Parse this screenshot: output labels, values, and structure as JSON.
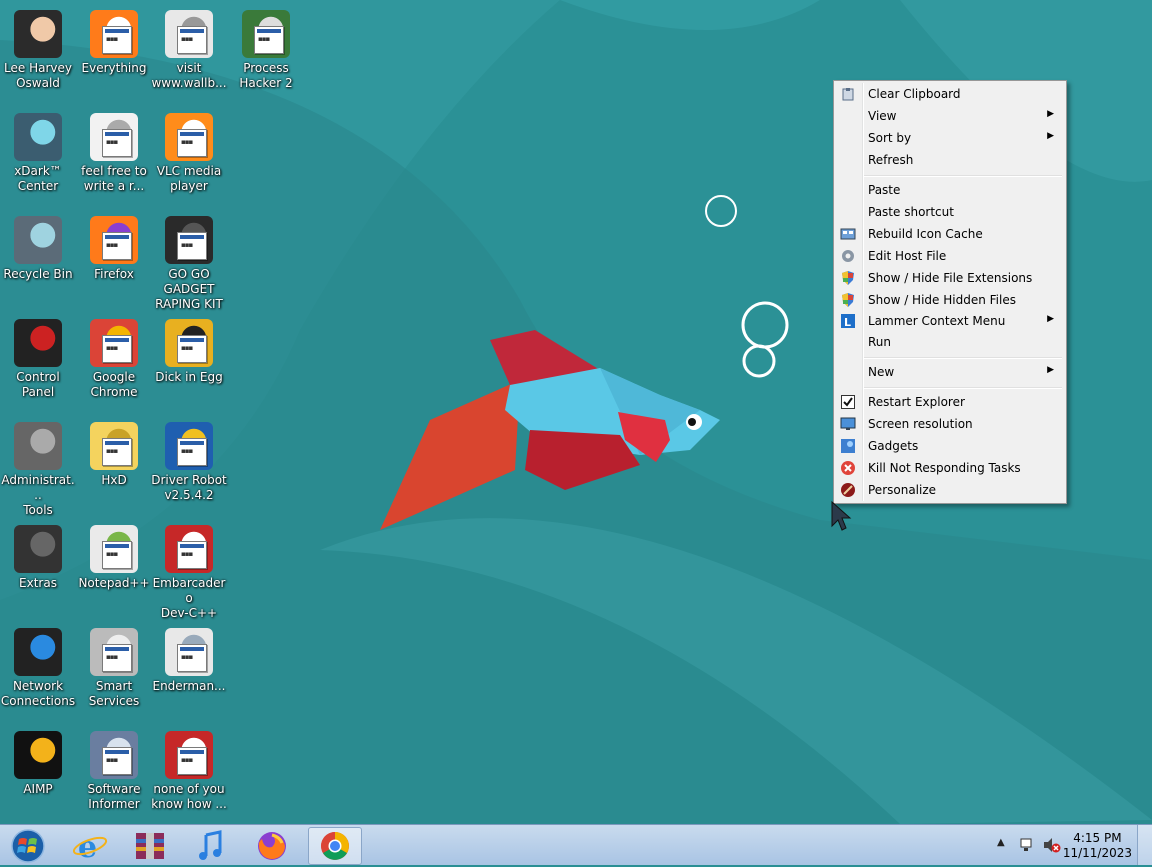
{
  "desktop_icons": [
    {
      "label": "Lee Harvey\nOswald"
    },
    {
      "label": "Everything"
    },
    {
      "label": "visit\nwww.wallb..."
    },
    {
      "label": "Process\nHacker 2"
    },
    {
      "label": "xDark™\nCenter"
    },
    {
      "label": "feel free to\nwrite a r..."
    },
    {
      "label": "VLC media\nplayer"
    },
    {
      "label": "Recycle Bin"
    },
    {
      "label": "Firefox"
    },
    {
      "label": "GO GO\nGADGET\nRAPING KIT"
    },
    {
      "label": "Control Panel"
    },
    {
      "label": "Google\nChrome"
    },
    {
      "label": "Dick in Egg"
    },
    {
      "label": "Administrat...\nTools"
    },
    {
      "label": "HxD"
    },
    {
      "label": "Driver Robot\nv2.5.4.2"
    },
    {
      "label": "Extras"
    },
    {
      "label": "Notepad++"
    },
    {
      "label": "Embarcadero\nDev-C++"
    },
    {
      "label": "Network\nConnections"
    },
    {
      "label": "Smart\nServices"
    },
    {
      "label": "Enderman..."
    },
    {
      "label": "AIMP"
    },
    {
      "label": "Software\nInformer"
    },
    {
      "label": "none of you\nknow how ..."
    }
  ],
  "context_menu": {
    "items": [
      {
        "label": "Clear Clipboard",
        "icon": "clipboard-icon"
      },
      {
        "label": "View",
        "submenu": true
      },
      {
        "label": "Sort by",
        "submenu": true
      },
      {
        "label": "Refresh"
      },
      {
        "label": "Paste"
      },
      {
        "label": "Paste shortcut"
      },
      {
        "label": "Rebuild Icon Cache",
        "icon": "icon-cache-icon"
      },
      {
        "label": "Edit Host File",
        "icon": "gear-icon"
      },
      {
        "label": "Show / Hide File Extensions",
        "icon": "shield-icon"
      },
      {
        "label": "Show / Hide Hidden Files",
        "icon": "shield-icon"
      },
      {
        "label": "Lammer Context Menu",
        "icon": "lammer-icon",
        "submenu": true
      },
      {
        "label": "Run"
      },
      {
        "label": "New",
        "submenu": true
      },
      {
        "label": "Restart Explorer",
        "icon": "checkbox-icon"
      },
      {
        "label": "Screen resolution",
        "icon": "monitor-icon"
      },
      {
        "label": "Gadgets",
        "icon": "gadgets-icon"
      },
      {
        "label": "Kill Not Responding Tasks",
        "icon": "kill-icon"
      },
      {
        "label": "Personalize",
        "icon": "personalize-icon"
      }
    ],
    "arrow": "▶"
  },
  "taskbar": {
    "apps": [
      "start-orb",
      "internet-explorer",
      "winrar",
      "itunes",
      "firefox",
      "chrome"
    ],
    "tray_arrow": "▲",
    "clock": {
      "time": "4:15 PM",
      "date": "11/11/2023"
    }
  }
}
